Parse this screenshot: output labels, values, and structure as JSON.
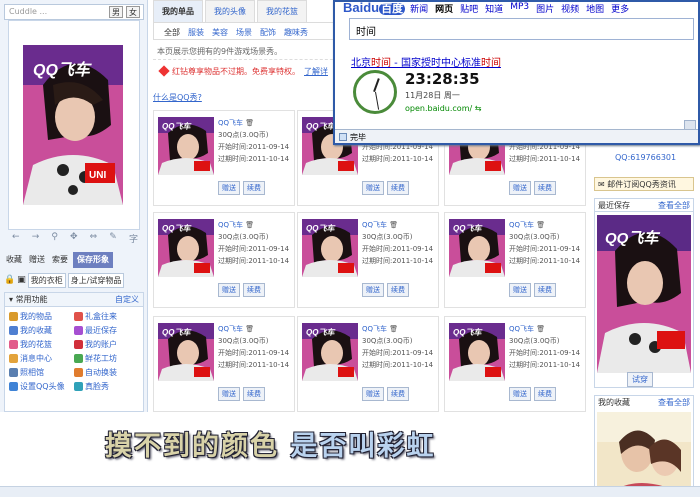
{
  "left": {
    "title": "Cuddle ...",
    "gender_male": "男",
    "gender_female": "女",
    "tool_zi": "字",
    "actions": [
      "收藏",
      "赠送",
      "索要"
    ],
    "save_label": "保存形象",
    "closet_label": "我的衣柜",
    "tryon_label": "身上/试穿物品",
    "func_title": "常用功能",
    "func_custom": "自定义",
    "func_items": [
      {
        "label": "我的物品",
        "color": "#d99a2b"
      },
      {
        "label": "礼盒往来",
        "color": "#e0524a"
      },
      {
        "label": "我的收藏",
        "color": "#4f7fd1"
      },
      {
        "label": "最近保存",
        "color": "#a64fd1"
      },
      {
        "label": "我的花篮",
        "color": "#e25c8a"
      },
      {
        "label": "我的账户",
        "color": "#d12f3a"
      },
      {
        "label": "消息中心",
        "color": "#e3a33b"
      },
      {
        "label": "鲜花工坊",
        "color": "#49a852"
      },
      {
        "label": "照相馆",
        "color": "#5a7fb0"
      },
      {
        "label": "自动换装",
        "color": "#e07c2e"
      },
      {
        "label": "设置QQ头像",
        "color": "#3f83d6"
      },
      {
        "label": "真脸秀",
        "color": "#2fa1b8"
      }
    ]
  },
  "mid": {
    "tabs": [
      "我的单品",
      "我的头像",
      "我的花篮"
    ],
    "subcats": [
      "全部",
      "服装",
      "美容",
      "场景",
      "配饰",
      "趣味秀"
    ],
    "notice": "本页展示您拥有的9件游戏场景秀。",
    "red_notice": "红钻尊享物品不过期。免费享特权。",
    "red_link": "了解详",
    "whatis": "什么是QQ秀?",
    "card": {
      "name": "QQ飞车",
      "price": "30Q点(3.0Q币)",
      "start": "开始时间:2011-09-14",
      "expire": "过期时间:2011-10-14",
      "gift": "赠送",
      "renew": "续费"
    }
  },
  "right": {
    "qq": "QQ:619766301",
    "subscribe": "邮件订阅QQ秀资讯",
    "recent_title": "最近保存",
    "view_all": "查看全部",
    "tryon": "试穿",
    "collection_title": "我的收藏"
  },
  "ie": {
    "logo": "Baidu",
    "logo_mid": "百度",
    "nav": [
      "新闻",
      "网页",
      "贴吧",
      "知道",
      "MP3",
      "图片",
      "视频",
      "地图",
      "更多"
    ],
    "query": "时间",
    "result_prefix": "北京",
    "result_em1": "时间",
    "result_mid": " - 国家授时中心标准",
    "result_em2": "时间",
    "time": "23:28:35",
    "date": "11月28日   周一",
    "url": "open.baidu.com/",
    "status": "完毕"
  },
  "bottom": {
    "lyric1": "摸不到的颜色",
    "lyric2": "是否叫彩虹"
  }
}
